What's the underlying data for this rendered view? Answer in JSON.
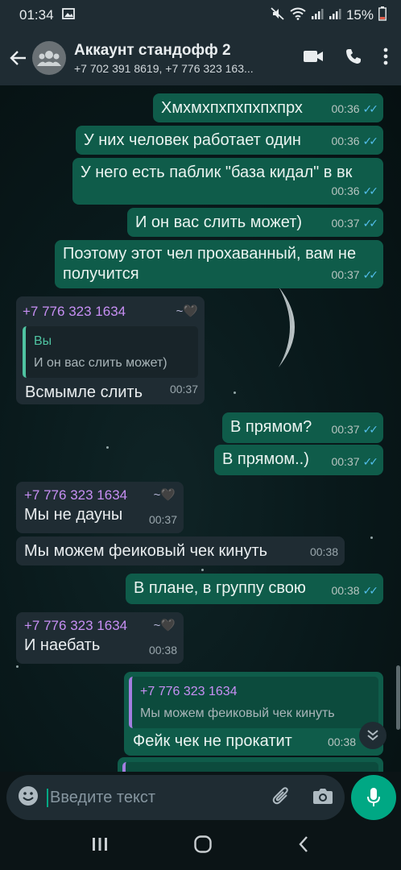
{
  "status_bar": {
    "time": "01:34",
    "battery": "15%"
  },
  "header": {
    "title": "Аккаунт стандофф 2",
    "subtitle": "+7 702 391 8619, +7 776 323 163..."
  },
  "messages": [
    {
      "text": "Хмхмхпхпхпхпхпрх",
      "time": "00:36"
    },
    {
      "text": "У них человек работает один",
      "time": "00:36"
    },
    {
      "text": "У него есть паблик \"база кидал\" в вк",
      "time": "00:36"
    },
    {
      "text": "И он вас слить может)",
      "time": "00:37"
    },
    {
      "text": "Поэтому этот чел прохаванный, вам не получится",
      "time": "00:37"
    },
    {
      "sender": "+7 776 323 1634",
      "quote_name": "Вы",
      "quote_text": "И он вас слить может)",
      "text": "Всмымле слить",
      "time": "00:37"
    },
    {
      "text": "В прямом?",
      "time": "00:37"
    },
    {
      "text": "В прямом..)",
      "time": "00:37"
    },
    {
      "sender": "+7 776 323 1634",
      "text": "Мы не дауны",
      "time": "00:37"
    },
    {
      "text": "Мы можем феиковый чек кинуть",
      "time": "00:38"
    },
    {
      "text": "В плане, в группу свою",
      "time": "00:38"
    },
    {
      "sender": "+7 776 323 1634",
      "text": "И наебать",
      "time": "00:38"
    },
    {
      "quote_name": "+7 776 323 1634",
      "quote_text": "Мы можем феиковый чек кинуть",
      "text": "Фейк чек не прокатит",
      "time": "00:38"
    }
  ],
  "input": {
    "placeholder": "Введите текст"
  },
  "icons": {
    "tick": "double-check",
    "heart": "black-heart"
  },
  "colors": {
    "outgoing": "#0f5c4a",
    "incoming": "#1f2c33",
    "accent": "#00a884",
    "sender": "#c78ff4",
    "ticks": "#53bdeb"
  }
}
